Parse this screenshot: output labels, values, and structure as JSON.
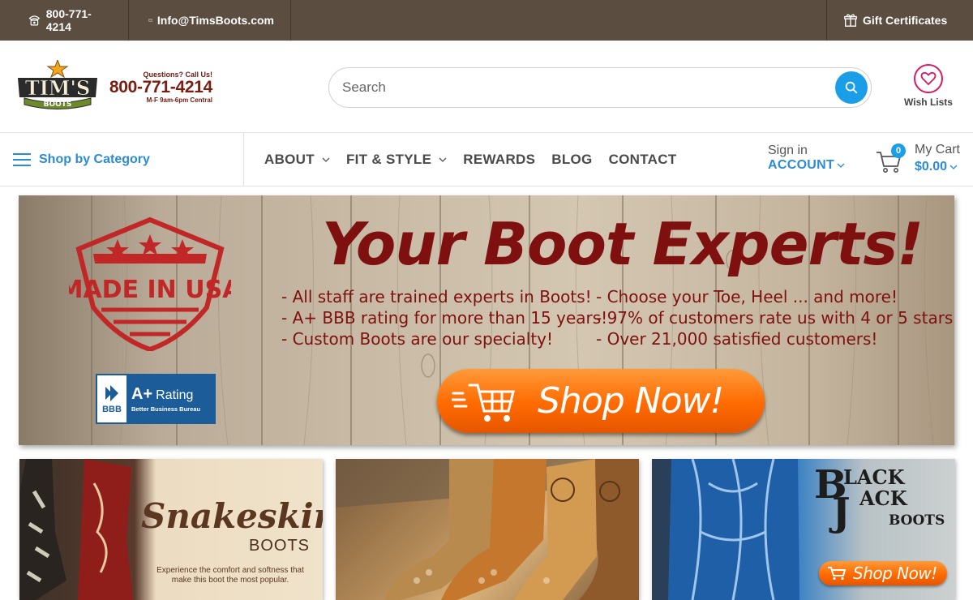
{
  "topbar": {
    "phone": "800-771-4214",
    "email": "Info@TimsBoots.com",
    "gift": "Gift Certificates"
  },
  "header": {
    "logo_text": "TIM'S BOOTS",
    "call_question": "Questions? Call Us!",
    "call_number": "800-771-4214",
    "call_hours": "M-F  9am-6pm Central",
    "search_placeholder": "Search",
    "wishlist_label": "Wish Lists"
  },
  "nav": {
    "category_label": "Shop by Category",
    "menu": [
      {
        "label": "ABOUT",
        "has_dropdown": true
      },
      {
        "label": "FIT & STYLE",
        "has_dropdown": true
      },
      {
        "label": "REWARDS",
        "has_dropdown": false
      },
      {
        "label": "BLOG",
        "has_dropdown": false
      },
      {
        "label": "CONTACT",
        "has_dropdown": false
      }
    ],
    "signin_label": "Sign in",
    "account_label": "ACCOUNT",
    "cart_label": "My Cart",
    "cart_total": "$0.00",
    "cart_count": "0"
  },
  "hero": {
    "title": "Your Boot Experts!",
    "bullets_left": [
      "- All staff are trained experts in Boots!",
      "- A+ BBB rating for more than 15 years!",
      "- Custom Boots are our specialty!"
    ],
    "bullets_right": [
      "- Choose your Toe, Heel ... and more!",
      "- 97% of customers rate us with 4 or 5 stars",
      "- Over 21,000 satisfied customers!"
    ],
    "made_in_usa": "MADE IN USA",
    "bbb_rating": "A+",
    "bbb_rating_word": "Rating",
    "bbb_sub": "Better Business Bureau",
    "bbb_seal": "BBB",
    "shop_now": "Shop Now!"
  },
  "tiles": {
    "snakeskin_title": "Snakeskin",
    "snakeskin_sub": "BOOTS",
    "snakeskin_desc": "Experience the comfort and softness that make this boot the most popular.",
    "bj_b": "B",
    "bj_j": "J",
    "bj_line1": "LACK",
    "bj_line2": "ACK",
    "bj_boots": "BOOTS",
    "bj_shop": "Shop Now!"
  },
  "colors": {
    "topbar_bg": "#5b4d40",
    "accent_blue": "#2a8bd8",
    "search_button": "#1a9ee8",
    "wish_pink": "#d81b60",
    "banner_red": "#7e1010",
    "shop_orange": "#ff6a00"
  }
}
